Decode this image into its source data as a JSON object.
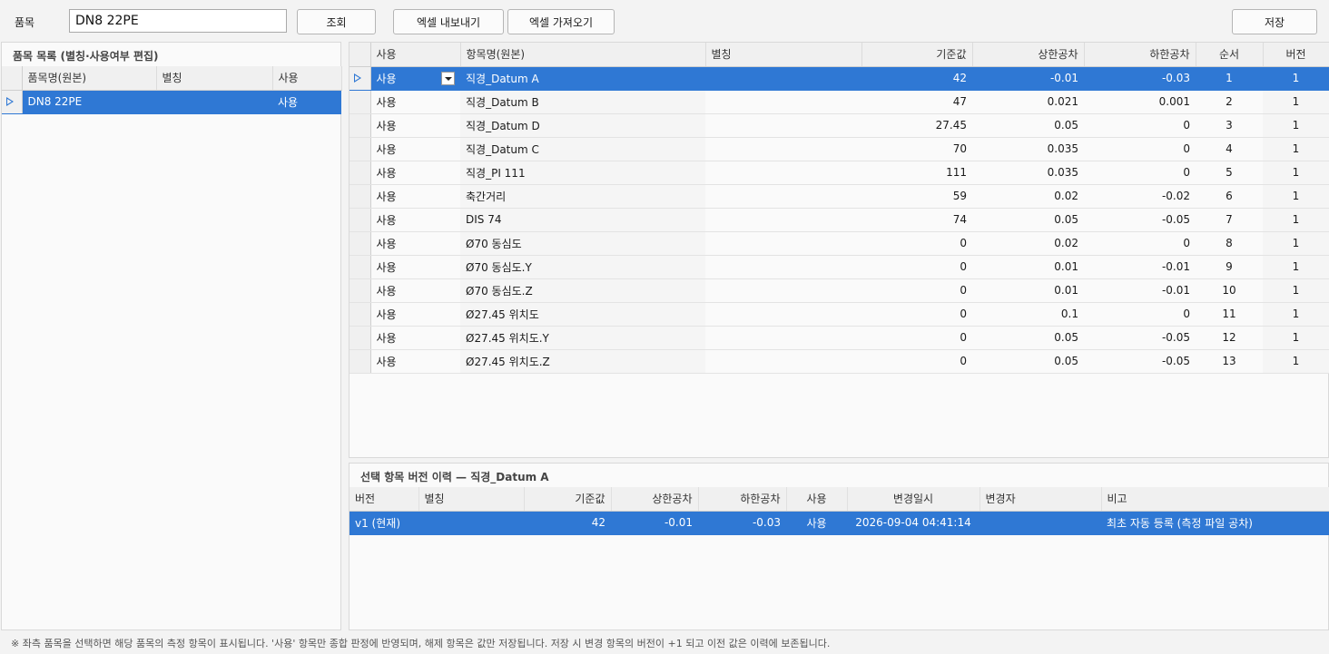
{
  "toolbar": {
    "item_label": "품목",
    "item_value": "DN8 22PE",
    "query_label": "조회",
    "export_label": "엑셀 내보내기",
    "import_label": "엑셀 가져오기",
    "save_label": "저장"
  },
  "left": {
    "title": "품목 목록 (별칭·사용여부 편집)",
    "headers": [
      "품목명(원본)",
      "별칭",
      "사용"
    ],
    "rows": [
      {
        "name": "DN8 22PE",
        "alias": "",
        "use": "사용"
      }
    ]
  },
  "main": {
    "headers": [
      "사용",
      "항목명(원본)",
      "별칭",
      "기준값",
      "상한공차",
      "하한공차",
      "순서",
      "버전"
    ],
    "rows": [
      {
        "use": "사용",
        "name": "직경_Datum A",
        "alias": "",
        "base": "42",
        "upper": "-0.01",
        "lower": "-0.03",
        "order": "1",
        "ver": "1"
      },
      {
        "use": "사용",
        "name": "직경_Datum B",
        "alias": "",
        "base": "47",
        "upper": "0.021",
        "lower": "0.001",
        "order": "2",
        "ver": "1"
      },
      {
        "use": "사용",
        "name": "직경_Datum D",
        "alias": "",
        "base": "27.45",
        "upper": "0.05",
        "lower": "0",
        "order": "3",
        "ver": "1"
      },
      {
        "use": "사용",
        "name": "직경_Datum C",
        "alias": "",
        "base": "70",
        "upper": "0.035",
        "lower": "0",
        "order": "4",
        "ver": "1"
      },
      {
        "use": "사용",
        "name": "직경_PI 111",
        "alias": "",
        "base": "111",
        "upper": "0.035",
        "lower": "0",
        "order": "5",
        "ver": "1"
      },
      {
        "use": "사용",
        "name": "축간거리",
        "alias": "",
        "base": "59",
        "upper": "0.02",
        "lower": "-0.02",
        "order": "6",
        "ver": "1"
      },
      {
        "use": "사용",
        "name": "DIS 74",
        "alias": "",
        "base": "74",
        "upper": "0.05",
        "lower": "-0.05",
        "order": "7",
        "ver": "1"
      },
      {
        "use": "사용",
        "name": "Ø70 동심도",
        "alias": "",
        "base": "0",
        "upper": "0.02",
        "lower": "0",
        "order": "8",
        "ver": "1"
      },
      {
        "use": "사용",
        "name": "Ø70 동심도.Y",
        "alias": "",
        "base": "0",
        "upper": "0.01",
        "lower": "-0.01",
        "order": "9",
        "ver": "1"
      },
      {
        "use": "사용",
        "name": "Ø70 동심도.Z",
        "alias": "",
        "base": "0",
        "upper": "0.01",
        "lower": "-0.01",
        "order": "10",
        "ver": "1"
      },
      {
        "use": "사용",
        "name": "Ø27.45 위치도",
        "alias": "",
        "base": "0",
        "upper": "0.1",
        "lower": "0",
        "order": "11",
        "ver": "1"
      },
      {
        "use": "사용",
        "name": "Ø27.45 위치도.Y",
        "alias": "",
        "base": "0",
        "upper": "0.05",
        "lower": "-0.05",
        "order": "12",
        "ver": "1"
      },
      {
        "use": "사용",
        "name": "Ø27.45 위치도.Z",
        "alias": "",
        "base": "0",
        "upper": "0.05",
        "lower": "-0.05",
        "order": "13",
        "ver": "1"
      }
    ]
  },
  "history": {
    "title": "선택 항목 버전 이력 — 직경_Datum A",
    "headers": [
      "버전",
      "별칭",
      "기준값",
      "상한공차",
      "하한공차",
      "사용",
      "변경일시",
      "변경자",
      "비고"
    ],
    "rows": [
      {
        "ver": "v1 (현재)",
        "alias": "",
        "base": "42",
        "upper": "-0.01",
        "lower": "-0.03",
        "use": "사용",
        "date": "2026-09-04 04:41:14",
        "user": "",
        "note": "최초 자동 등록 (측정 파일 공차)"
      }
    ]
  },
  "footer": "※ 좌측 품목을 선택하면 해당 품목의 측정 항목이 표시됩니다. '사용' 항목만 종합 판정에 반영되며, 해제 항목은 값만 저장됩니다. 저장 시 변경 항목의 버전이 +1 되고 이전 값은 이력에 보존됩니다.",
  "colors": {
    "selection": "#2f78d4"
  }
}
